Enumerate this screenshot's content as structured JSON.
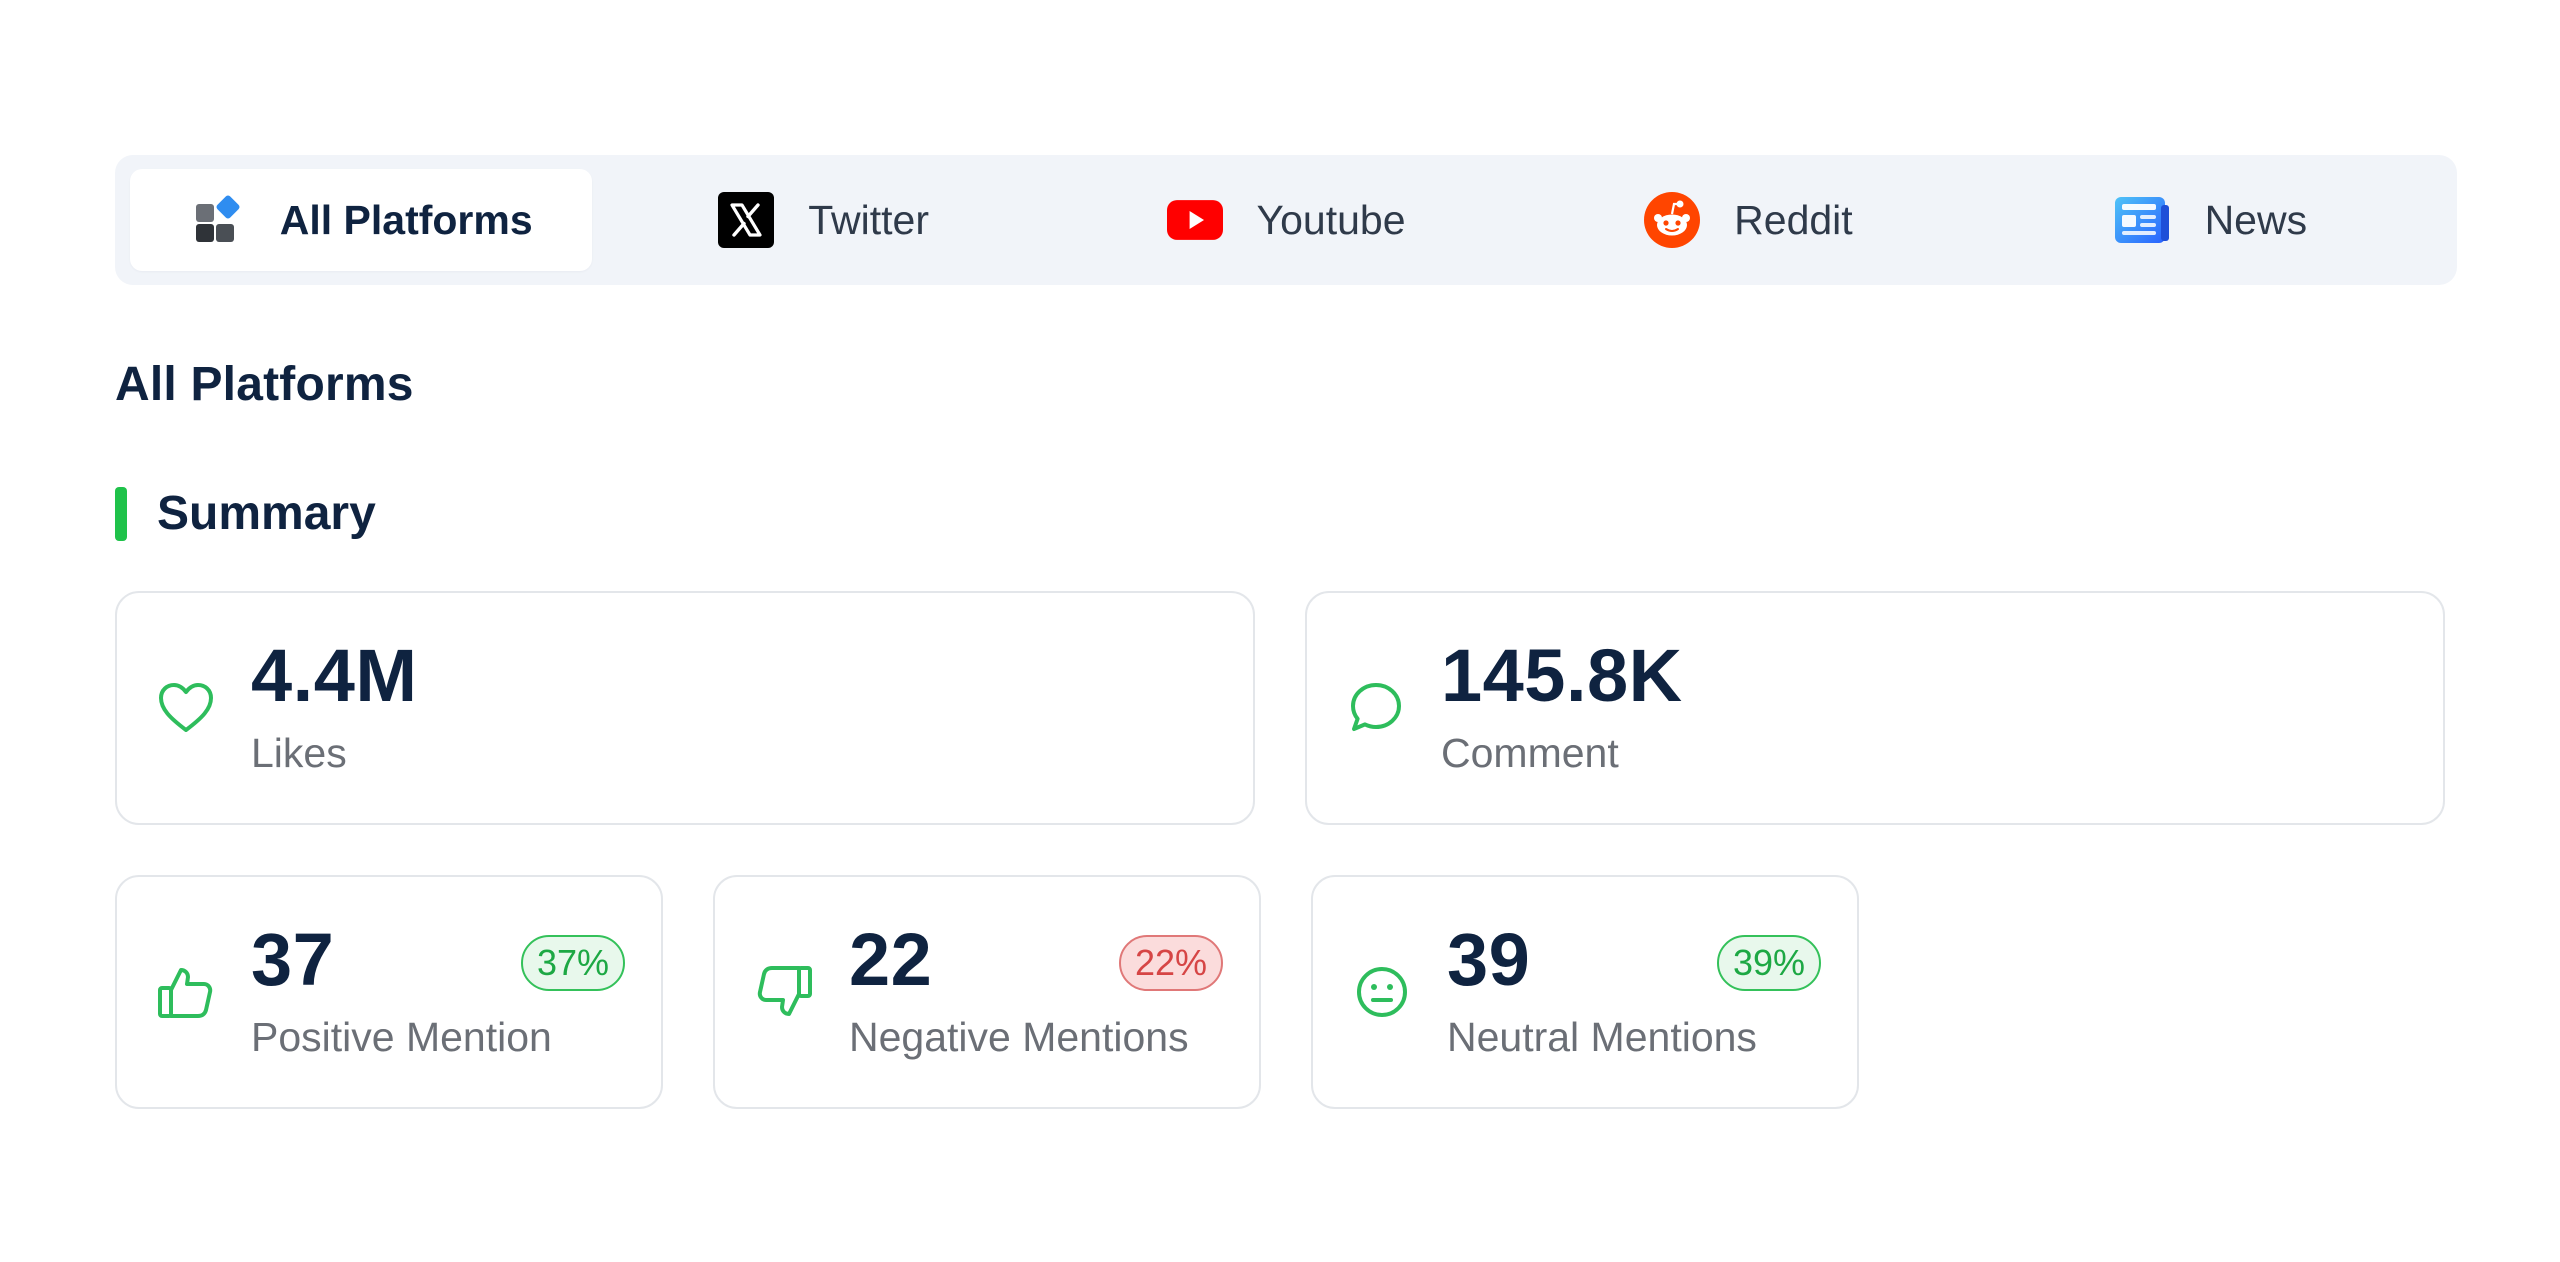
{
  "tabs": [
    {
      "label": "All Platforms",
      "icon": "all-platforms-icon",
      "active": true
    },
    {
      "label": "Twitter",
      "icon": "x-twitter-icon",
      "active": false
    },
    {
      "label": "Youtube",
      "icon": "youtube-icon",
      "active": false
    },
    {
      "label": "Reddit",
      "icon": "reddit-icon",
      "active": false
    },
    {
      "label": "News",
      "icon": "news-icon",
      "active": false
    }
  ],
  "page_title": "All Platforms",
  "summary": {
    "title": "Summary",
    "accent_color": "#1fc24a",
    "big_cards": [
      {
        "value": "4.4M",
        "label": "Likes",
        "icon": "heart-icon"
      },
      {
        "value": "145.8K",
        "label": "Comment",
        "icon": "comment-icon"
      }
    ],
    "small_cards": [
      {
        "value": "37",
        "label": "Positive Mention",
        "badge": "37%",
        "badge_tone": "green",
        "icon": "thumbs-up-icon"
      },
      {
        "value": "22",
        "label": "Negative Mentions",
        "badge": "22%",
        "badge_tone": "red",
        "icon": "thumbs-down-icon"
      },
      {
        "value": "39",
        "label": "Neutral Mentions",
        "badge": "39%",
        "badge_tone": "green",
        "icon": "neutral-face-icon"
      }
    ]
  },
  "colors": {
    "icon_green": "#2ebd5c",
    "positive_badge": "#1da844",
    "negative_badge": "#d64545",
    "twitter": "#000000",
    "youtube": "#ff0000",
    "reddit": "#ff4500",
    "news": "#2f8df0"
  }
}
